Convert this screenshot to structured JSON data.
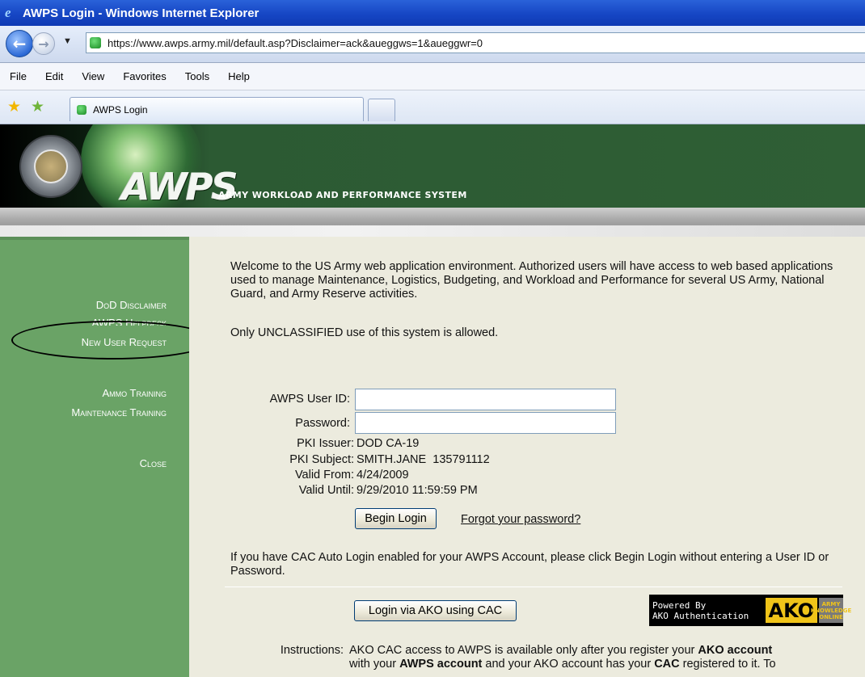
{
  "window": {
    "title": "AWPS Login - Windows Internet Explorer"
  },
  "navbar": {
    "address": "https://www.awps.army.mil/default.asp?Disclaimer=ack&aueggws=1&aueggwr=0"
  },
  "menu": {
    "items": [
      "File",
      "Edit",
      "View",
      "Favorites",
      "Tools",
      "Help"
    ]
  },
  "tab": {
    "label": "AWPS Login"
  },
  "banner": {
    "logo": "AWPS",
    "subtitle": "ARMY WORKLOAD AND PERFORMANCE SYSTEM",
    "colors": {
      "banner_green": "#2f5f35",
      "sidebar_green": "#6aa366",
      "content_bg": "#ecebde"
    }
  },
  "sidebar": {
    "links": [
      {
        "label": "DoD Disclaimer"
      },
      {
        "label": "AWPS Helpdesk"
      },
      {
        "label": "New User Request"
      },
      {
        "label": "Ammo Training"
      },
      {
        "label": "Maintenance Training"
      },
      {
        "label": "Close"
      }
    ]
  },
  "content": {
    "welcome": "Welcome to the US Army web application environment. Authorized users will have access to web based applications used to manage Maintenance, Logistics, Budgeting, and Workload and Performance for several US Army, National Guard, and Army Reserve activities.",
    "unclassified": "Only UNCLASSIFIED use of this system is allowed.",
    "form": {
      "userid_label": "AWPS User ID:",
      "userid_value": "",
      "password_label": "Password:",
      "password_value": "",
      "pki_issuer_label": "PKI Issuer:",
      "pki_issuer_value": "DOD CA-19",
      "pki_subject_label": "PKI Subject:",
      "pki_subject_value": "SMITH.JANE  135791112",
      "valid_from_label": "Valid From:",
      "valid_from_value": "4/24/2009",
      "valid_until_label": "Valid Until:",
      "valid_until_value": "9/29/2010 11:59:59 PM",
      "begin_login": "Begin Login",
      "forgot_password": "Forgot your password?"
    },
    "cac_note": "If you have CAC Auto Login enabled for your AWPS Account, please click Begin Login without entering a User ID or Password.",
    "ako_button": "Login via AKO using CAC",
    "ako_badge": {
      "line1": "Powered By",
      "line2": "AKO Authentication",
      "mark": "AKO",
      "army": "ARMY KNOWLEDGE ONLINE"
    },
    "instructions_label": "Instructions:",
    "instructions": {
      "t1": "AKO CAC access to AWPS is available only after you register your ",
      "b1": "AKO account",
      "t2": "with your ",
      "b2": "AWPS account",
      "t3": " and your AKO account has your ",
      "b3": "CAC",
      "t4": " registered to it. To"
    }
  }
}
